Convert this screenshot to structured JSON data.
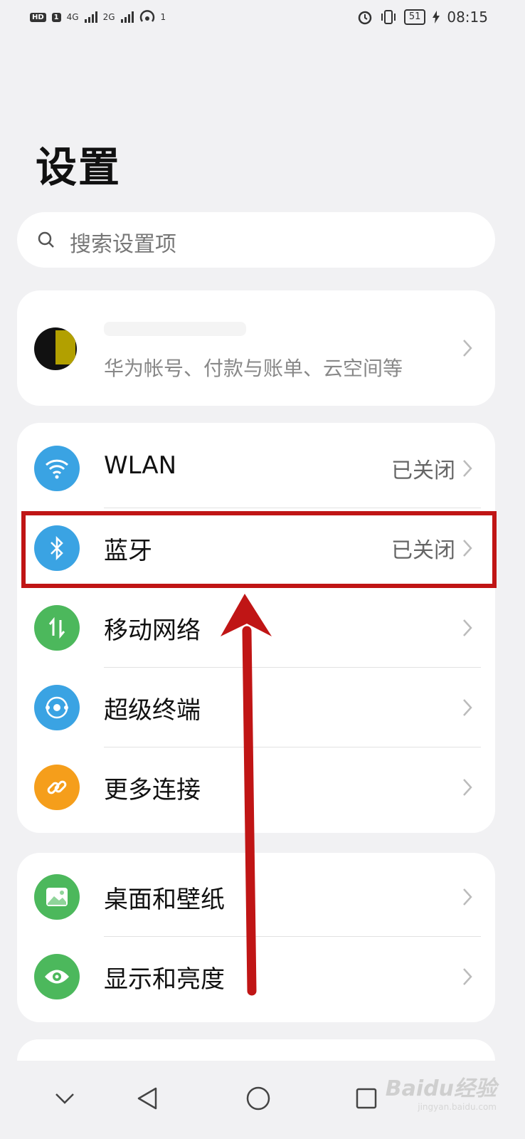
{
  "status_bar": {
    "left_chips": [
      "HD",
      "1"
    ],
    "net1": "4G",
    "net2": "2G",
    "hotspot_count": "1",
    "battery": "51",
    "time": "08:15"
  },
  "page_title": "设置",
  "search": {
    "placeholder": "搜索设置项"
  },
  "account": {
    "subtitle": "华为帐号、付款与账单、云空间等"
  },
  "connectivity": [
    {
      "label": "WLAN",
      "status": "已关闭",
      "icon": "wifi-icon",
      "color": "#3aa3e3"
    },
    {
      "label": "蓝牙",
      "status": "已关闭",
      "icon": "bluetooth-icon",
      "color": "#3aa3e3"
    },
    {
      "label": "移动网络",
      "status": "",
      "icon": "mobile-data-icon",
      "color": "#4cb85c"
    },
    {
      "label": "超级终端",
      "status": "",
      "icon": "super-device-icon",
      "color": "#3aa3e3"
    },
    {
      "label": "更多连接",
      "status": "",
      "icon": "link-icon",
      "color": "#f59e1b"
    }
  ],
  "display": [
    {
      "label": "桌面和壁纸",
      "icon": "wallpaper-icon",
      "color": "#4cb85c"
    },
    {
      "label": "显示和亮度",
      "icon": "eye-icon",
      "color": "#4cb85c"
    }
  ],
  "annotation": {
    "color": "#c01515"
  },
  "watermark": {
    "brand": "Baidu经验",
    "url": "jingyan.baidu.com"
  }
}
